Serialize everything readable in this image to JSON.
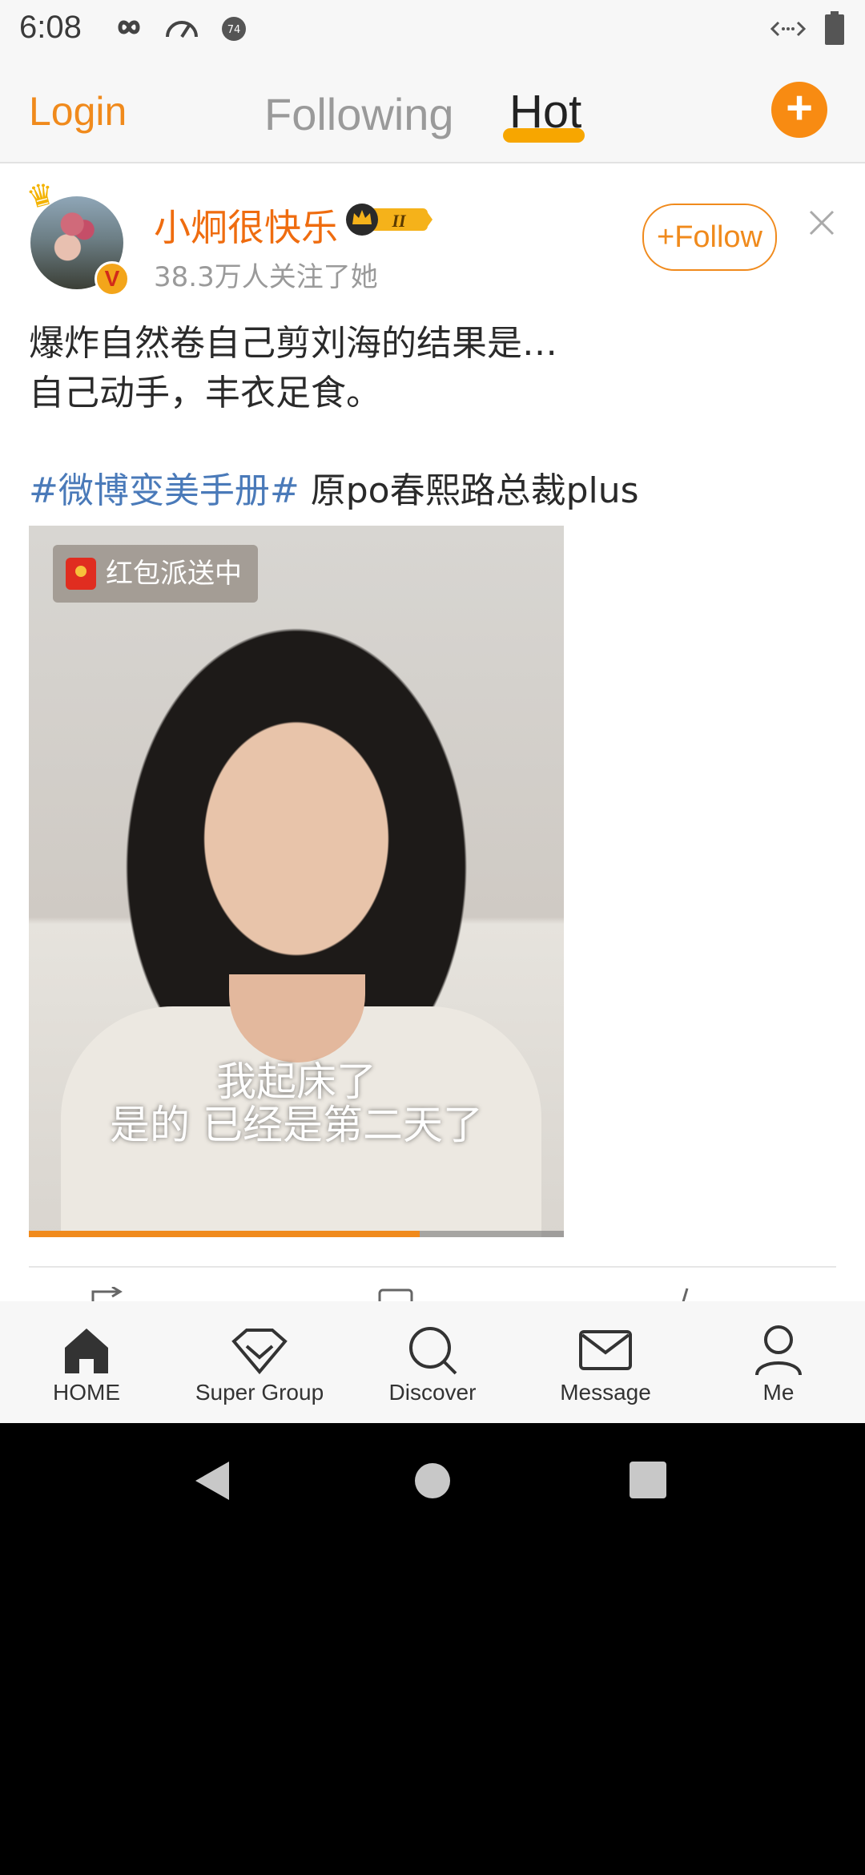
{
  "status_bar": {
    "time": "6:08"
  },
  "top_nav": {
    "login": "Login",
    "following": "Following",
    "hot": "Hot",
    "create_icon": "plus-icon"
  },
  "post": {
    "username": "小炯很快乐",
    "followers": "38.3万人关注了她",
    "follow_label": "Follow",
    "text_line1": "爆炸自然卷自己剪刘海的结果是…",
    "text_line2": "自己动手，丰衣足食。",
    "hashtag": "#微博变美手册#",
    "text_line3": " 原po春熙路总裁plus",
    "media": {
      "badge": "红包派送中",
      "caption_line1": "我起床了",
      "caption_line2": "是的 已经是第二天了",
      "progress": 0.73
    }
  },
  "bottom_nav": {
    "home": "HOME",
    "super_group": "Super Group",
    "discover": "Discover",
    "message": "Message",
    "me": "Me"
  },
  "colors": {
    "accent": "#f08a1c",
    "hashtag": "#4a7ab9",
    "hot_underline": "#f7a600"
  }
}
